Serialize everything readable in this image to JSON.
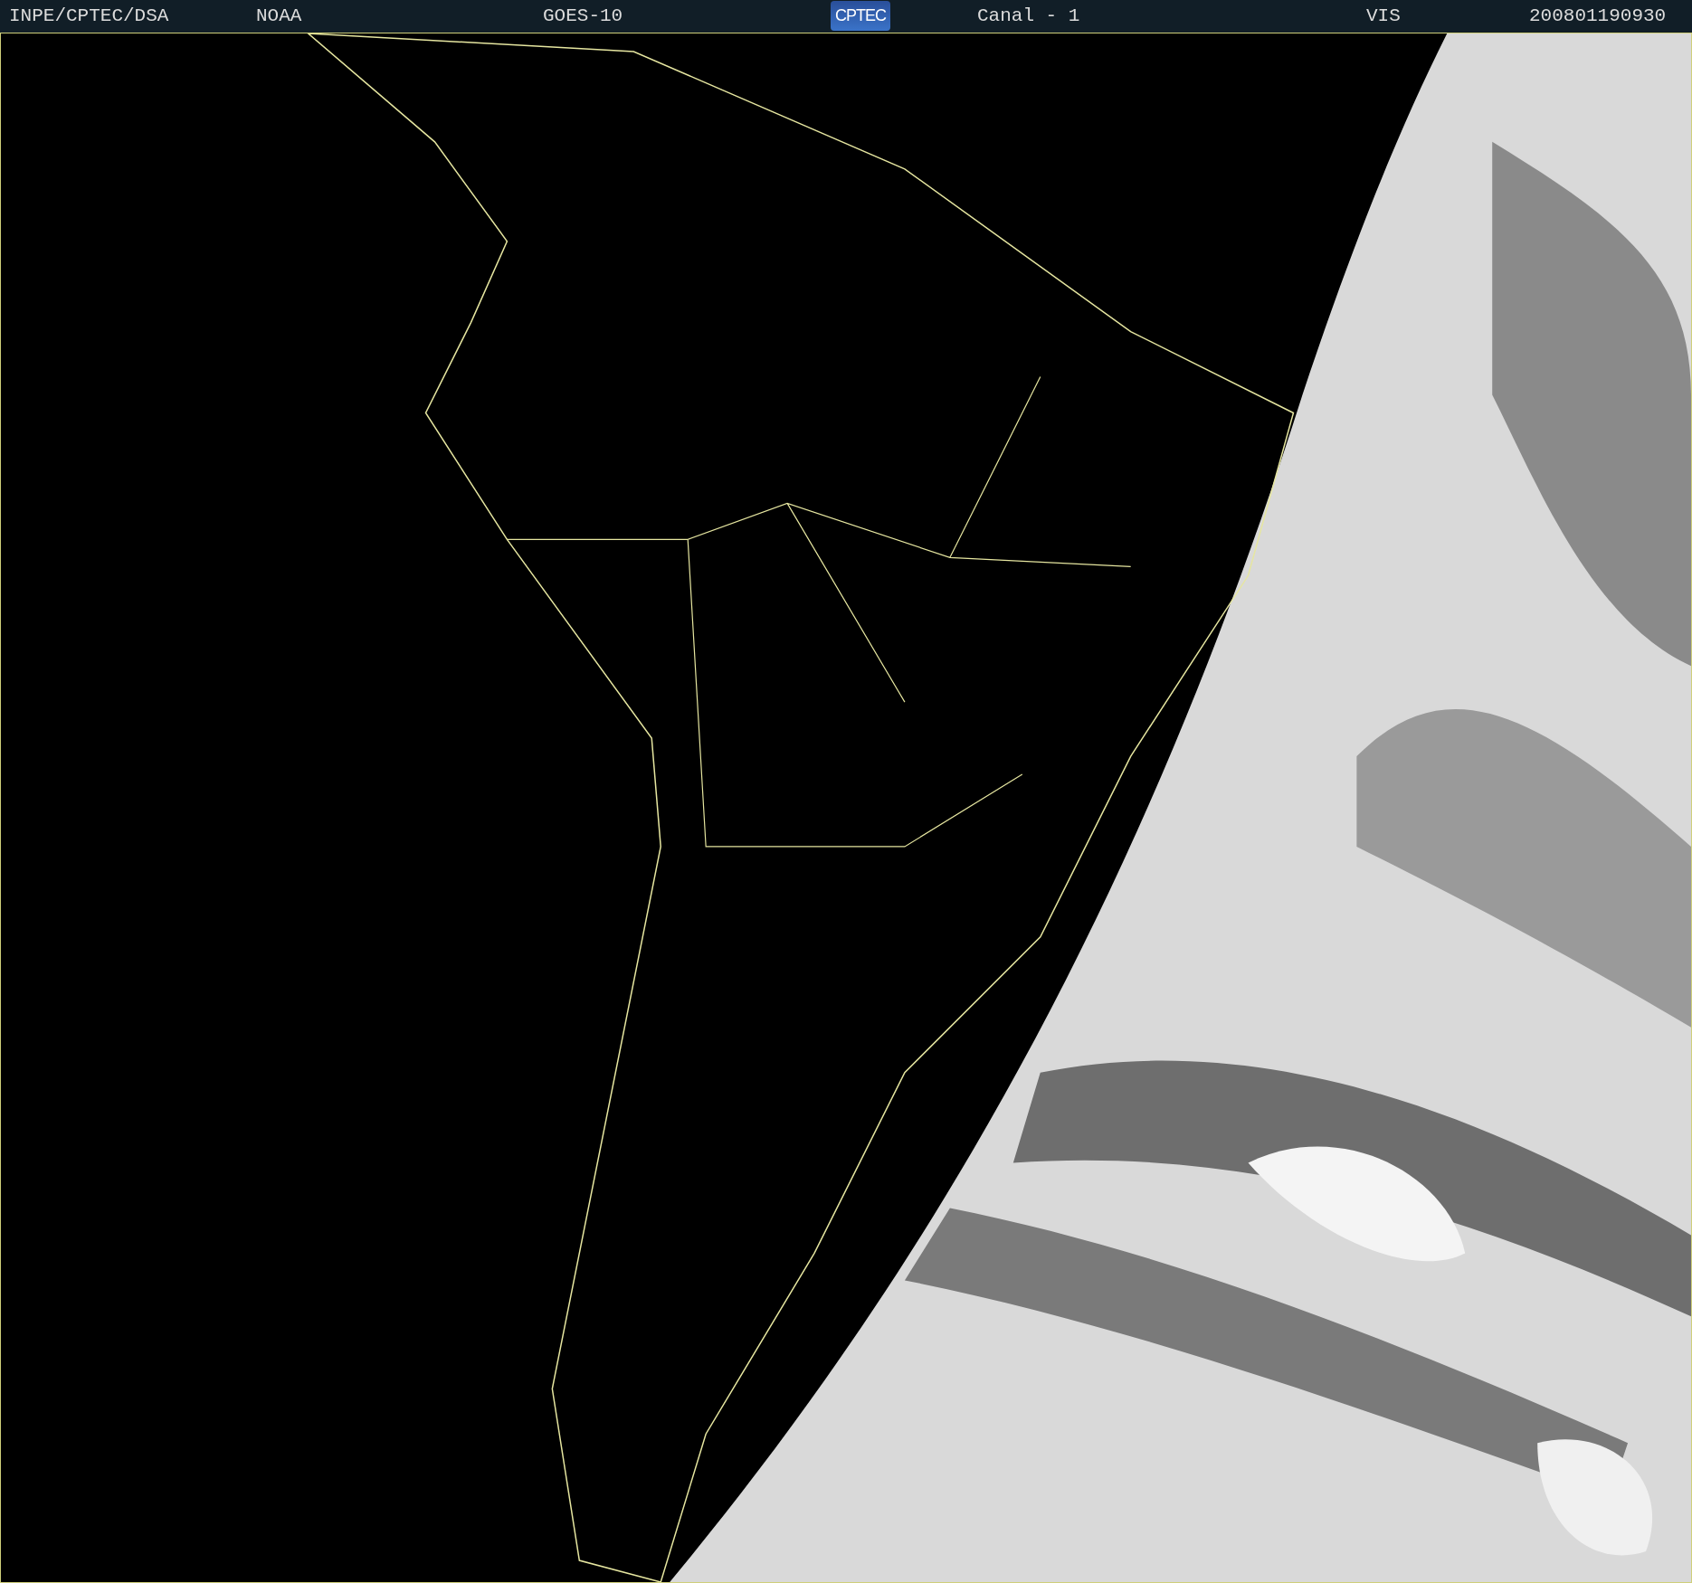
{
  "header": {
    "items": [
      {
        "kind": "text",
        "text": "INPE/CPTEC/DSA"
      },
      {
        "kind": "text",
        "text": "NOAA"
      },
      {
        "kind": "text",
        "text": "GOES-10"
      },
      {
        "kind": "logo",
        "text": "CPTEC"
      },
      {
        "kind": "text",
        "text": "Canal - 1"
      },
      {
        "kind": "text",
        "text": "VIS"
      },
      {
        "kind": "text",
        "text": "200801190930"
      }
    ]
  }
}
